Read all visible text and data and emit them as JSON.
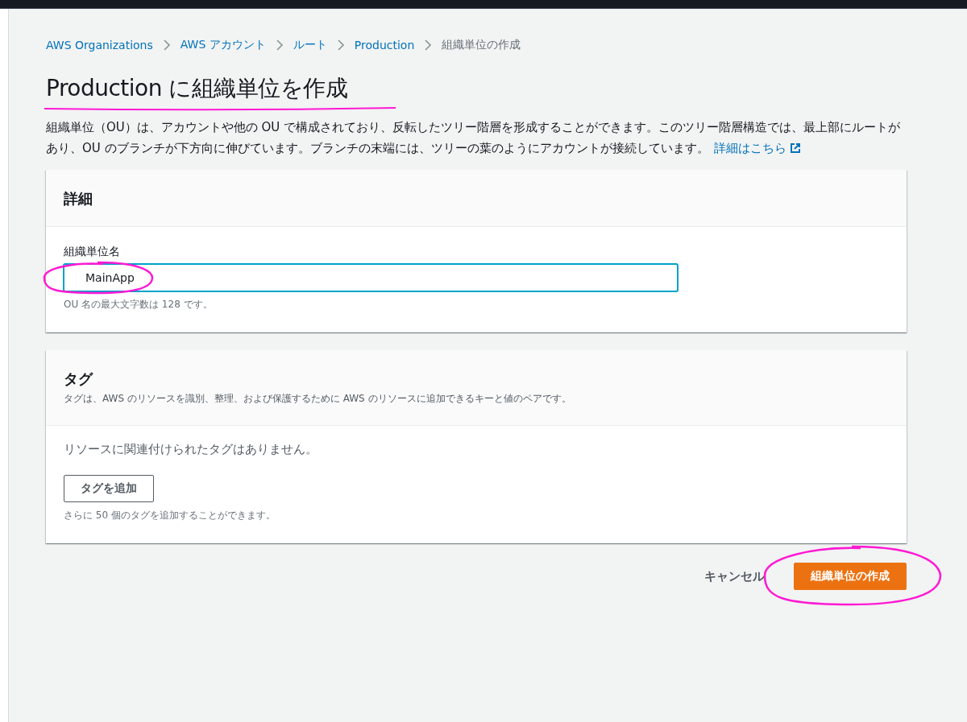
{
  "breadcrumbs": [
    {
      "label": "AWS Organizations",
      "link": true
    },
    {
      "label": "AWS アカウント",
      "link": true
    },
    {
      "label": "ルート",
      "link": true
    },
    {
      "label": "Production",
      "link": true
    },
    {
      "label": "組織単位の作成",
      "link": false
    }
  ],
  "title": "Production に組織単位を作成",
  "description": {
    "text": "組織単位（OU）は、アカウントや他の OU で構成されており、反転したツリー階層を形成することができます。このツリー階層構造では、最上部にルートがあり、OU のブランチが下方向に伸びています。ブランチの末端には、ツリーの葉のようにアカウントが接続しています。",
    "link": "詳細はこちら"
  },
  "details": {
    "heading": "詳細",
    "field_label": "組織単位名",
    "value": "MainApp",
    "hint": "OU 名の最大文字数は 128 です。"
  },
  "tags": {
    "heading": "タグ",
    "description": "タグは、AWS のリソースを識別、整理、および保護するために AWS のリソースに追加できるキーと値のペアです。",
    "empty": "リソースに関連付けられたタグはありません。",
    "add_button": "タグを追加",
    "limit": "さらに 50 個のタグを追加することができます。"
  },
  "actions": {
    "cancel": "キャンセル",
    "submit": "組織単位の作成"
  }
}
